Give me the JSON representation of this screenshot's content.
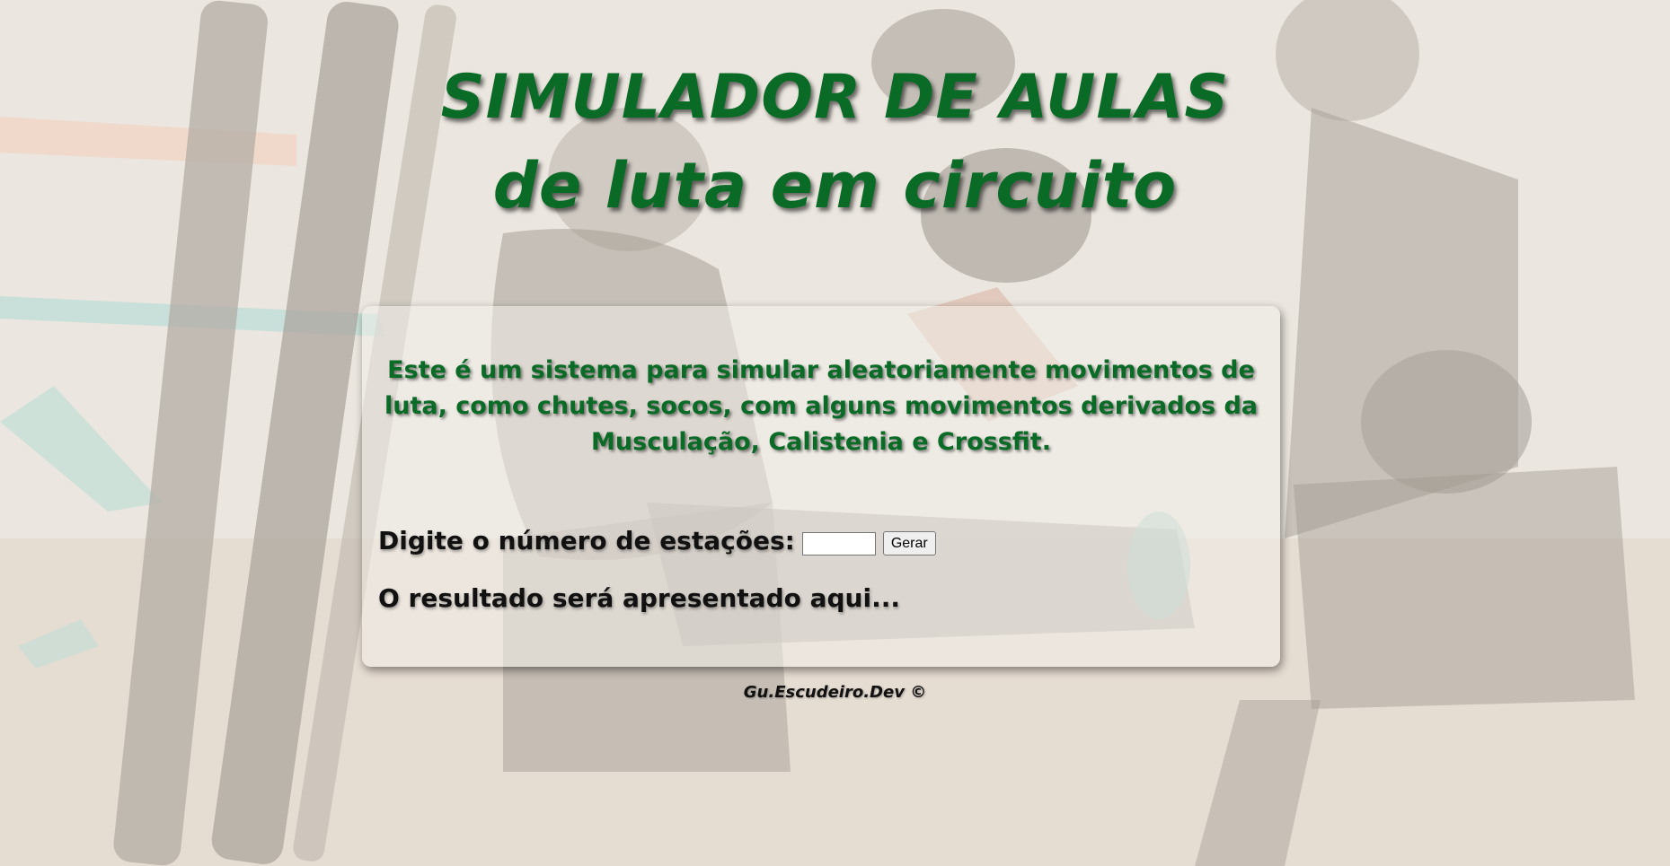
{
  "header": {
    "title_line1": "SIMULADOR DE AULAS",
    "title_line2": "de luta em circuito"
  },
  "card": {
    "description": "Este é um sistema para simular aleatoriamente movimentos de luta, como chutes, socos, com alguns movimentos derivados da Musculação, Calistenia e Crossfit.",
    "stations_label": "Digite o número de estações:",
    "stations_value": "",
    "generate_button": "Gerar",
    "result_text": "O resultado será apresentado aqui..."
  },
  "footer": {
    "credit": "Gu.Escudeiro.Dev ©"
  },
  "colors": {
    "title_green": "#0a6b26",
    "text_dark": "#111111",
    "background": "#ebe6df"
  }
}
